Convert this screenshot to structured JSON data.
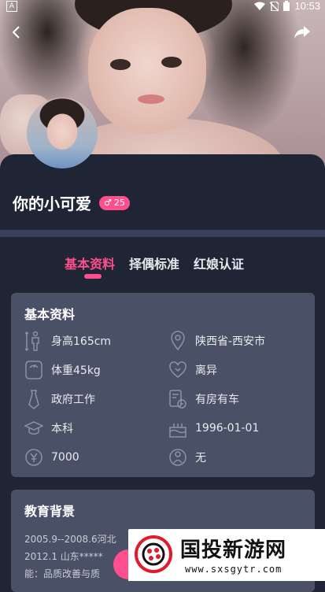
{
  "status_bar": {
    "left_icon": "A",
    "time": "10:53"
  },
  "profile": {
    "name": "你的小可爱",
    "gender_symbol": "♂",
    "age": "25"
  },
  "tabs": [
    {
      "label": "基本资料",
      "active": true
    },
    {
      "label": "择偶标准",
      "active": false
    },
    {
      "label": "红娘认证",
      "active": false
    }
  ],
  "basic_info": {
    "title": "基本资料",
    "height": {
      "icon": "height-icon",
      "text": "身高165cm"
    },
    "location": {
      "icon": "location-icon",
      "text": "陕西省-西安市"
    },
    "weight": {
      "icon": "weight-icon",
      "text": "体重45kg"
    },
    "marital": {
      "icon": "heart-icon",
      "text": "离异"
    },
    "job": {
      "icon": "tie-icon",
      "text": "政府工作"
    },
    "property": {
      "icon": "house-car-icon",
      "text": "有房有车"
    },
    "education": {
      "icon": "graduation-cap-icon",
      "text": "本科"
    },
    "birthday": {
      "icon": "cake-icon",
      "text": "1996-01-01"
    },
    "income": {
      "icon": "money-icon",
      "text": "7000"
    },
    "children": {
      "icon": "child-icon",
      "text": "无"
    }
  },
  "education_background": {
    "title": "教育背景",
    "lines": [
      "2005.9--2008.6河北",
      "2012.1 山东*****",
      "能：品质改善与质"
    ]
  },
  "watermark": {
    "title": "国投新游网",
    "url": "www.sxsgytr.com"
  },
  "colors": {
    "accent": "#ff4f8e",
    "background": "#1f2535",
    "card": "#4a5066"
  }
}
